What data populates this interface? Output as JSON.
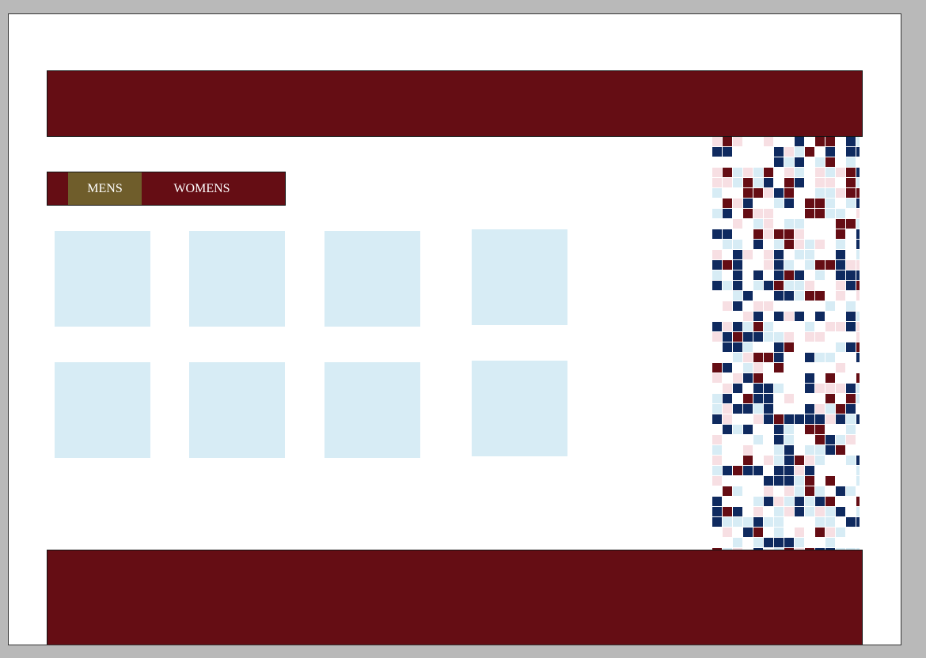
{
  "nav": {
    "tabs": [
      {
        "label": "MENS",
        "active": true
      },
      {
        "label": "WOMENS",
        "active": false
      }
    ]
  },
  "product_grid": {
    "rows": 2,
    "columns": 4
  },
  "colors": {
    "page_background": "#b9b9b9",
    "canvas": "#ffffff",
    "banner": "#650d14",
    "active_tab": "#6f5d2b",
    "tile": "#d7ecf5",
    "pattern_navy": "#0f2a5f",
    "pattern_maroon": "#650d14",
    "pattern_light_blue": "#d7ecf5",
    "pattern_pink": "#f7dfe3"
  },
  "icons": {
    "decorative_pattern": "pixel-grid-pattern-icon"
  }
}
